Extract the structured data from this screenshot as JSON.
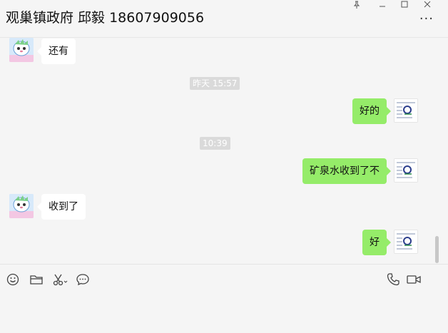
{
  "window": {
    "title": "观巢镇政府 邱毅 18607909056",
    "controls": [
      "pin-icon",
      "minimize-icon",
      "maximize-icon",
      "close-icon"
    ],
    "more_icon": "more-icon"
  },
  "chat": {
    "messages": [
      {
        "type": "message",
        "from": "other",
        "text": "还有"
      },
      {
        "type": "timestamp",
        "text": "昨天 15:57"
      },
      {
        "type": "message",
        "from": "self",
        "text": "好的"
      },
      {
        "type": "timestamp",
        "text": "10:39"
      },
      {
        "type": "message",
        "from": "self",
        "text": "矿泉水收到了不"
      },
      {
        "type": "message",
        "from": "other",
        "text": "收到了"
      },
      {
        "type": "message",
        "from": "self",
        "text": "好"
      }
    ]
  },
  "toolbar": {
    "left_tools": [
      "emoji-icon",
      "folder-icon",
      "scissors-icon",
      "chat-history-icon"
    ],
    "right_tools": [
      "phone-icon",
      "video-call-icon"
    ]
  },
  "colors": {
    "background": "#f5f5f5",
    "outgoing_bubble": "#95ec69",
    "incoming_bubble": "#ffffff",
    "timestamp_bg": "#dadada"
  }
}
